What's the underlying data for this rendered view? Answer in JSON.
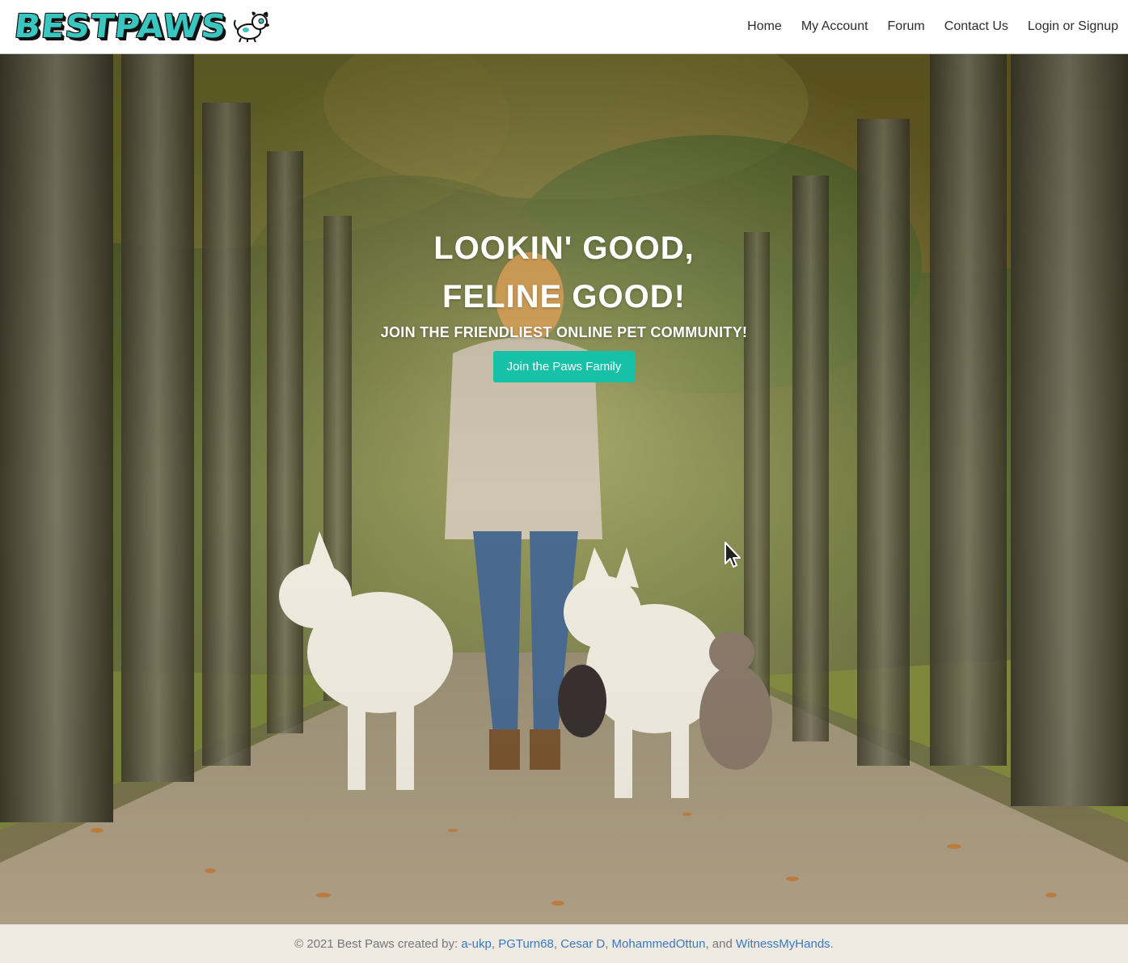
{
  "header": {
    "logo_text": "BESTPAWS",
    "logo_icon": "dog-mascot-icon",
    "brand_color": "#39c6c0",
    "nav": [
      {
        "label": "Home"
      },
      {
        "label": "My Account"
      },
      {
        "label": "Forum"
      },
      {
        "label": "Contact Us"
      },
      {
        "label": "Login or Signup"
      }
    ]
  },
  "hero": {
    "headline_line1": "LOOKIN' GOOD,",
    "headline_line2": "FELINE GOOD!",
    "subheadline": "JOIN THE FRIENDLIEST ONLINE PET COMMUNITY!",
    "cta_label": "Join the Paws Family",
    "cta_color": "#17c1a8"
  },
  "footer": {
    "prefix": "© 2021 Best Paws created by: ",
    "link_color": "#3a78c2",
    "contributors": [
      "a-ukp",
      "PGTurn68",
      "Cesar D",
      "MohammedOttun",
      "WitnessMyHands"
    ],
    "sep_comma": ", ",
    "sep_and": ", and ",
    "suffix": "."
  }
}
